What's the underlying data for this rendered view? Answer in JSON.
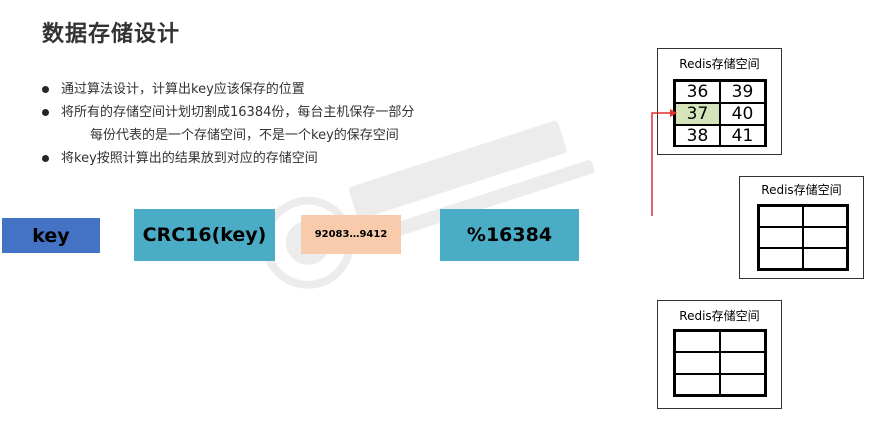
{
  "title": "数据存储设计",
  "bullets": [
    "通过算法设计，计算出key应该保存的位置",
    "将所有的存储空间计划切割成16384份，每台主机保存一部分",
    "每份代表的是一个存储空间，不是一个key的保存空间",
    "将key按照计算出的结果放到对应的存储空间"
  ],
  "flow": {
    "key": "key",
    "crc": "CRC16(key)",
    "range": "92083…9412",
    "mod": "%16384"
  },
  "nodes": [
    {
      "label": "Redis存储空间",
      "cells": [
        "36",
        "39",
        "37",
        "40",
        "38",
        "41"
      ],
      "highlight_index": 2
    },
    {
      "label": "Redis存储空间",
      "cells": [
        "",
        "",
        "",
        "",
        "",
        ""
      ]
    },
    {
      "label": "Redis存储空间",
      "cells": [
        "",
        "",
        "",
        "",
        "",
        ""
      ]
    }
  ],
  "colors": {
    "key_box": "#4472C4",
    "crc_box": "#4BACC6",
    "range_box": "#F8CBAD",
    "mod_box": "#4BACC6",
    "highlight_cell": "#D6E4BC",
    "arrow": "#E03030"
  }
}
